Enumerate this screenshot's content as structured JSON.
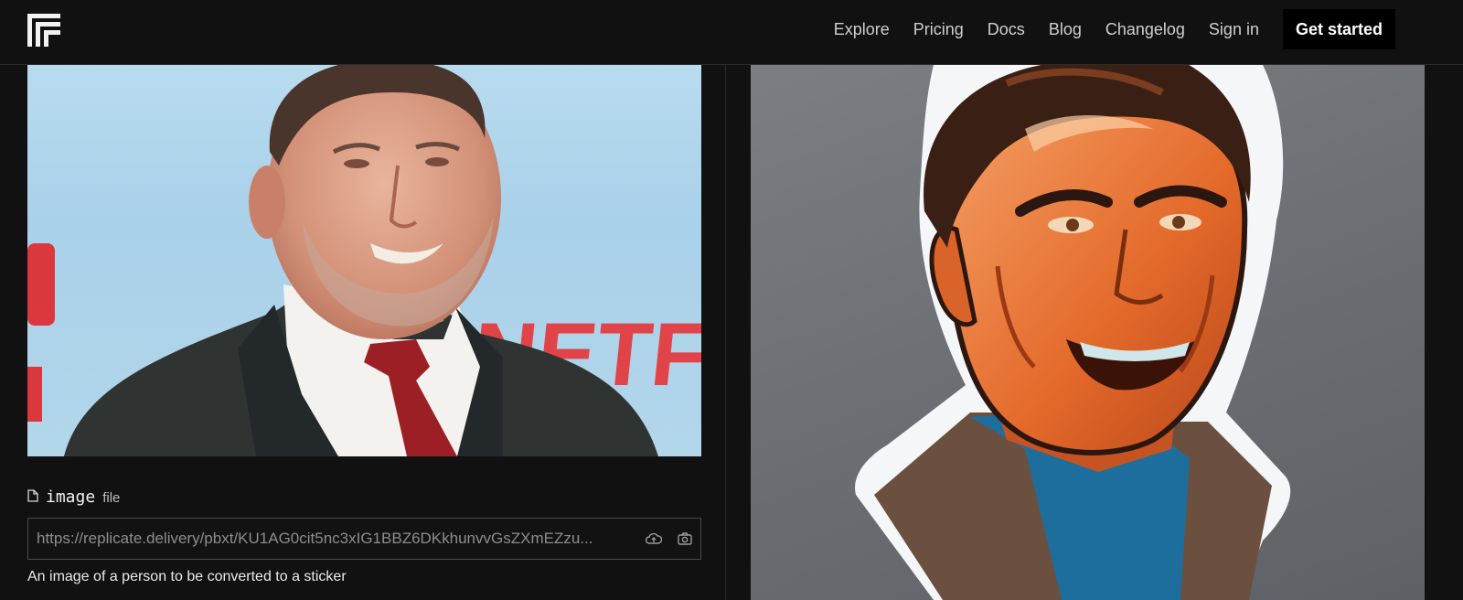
{
  "header": {
    "nav": [
      "Explore",
      "Pricing",
      "Docs",
      "Blog",
      "Changelog",
      "Sign in"
    ],
    "cta": "Get started"
  },
  "input": {
    "field_name": "image",
    "field_type": "file",
    "value": "https://replicate.delivery/pbxt/KU1AG0cit5nc3xIG1BBZ6DKkhunvvGsZXmEZzu...",
    "description": "An image of a person to be converted to a sticker",
    "icons": [
      "upload-cloud-icon",
      "camera-icon"
    ]
  },
  "photo": {
    "background_text": "NETFL"
  },
  "colors": {
    "page_bg": "#111111",
    "cta_bg": "#000000",
    "sticker_orange": "#e8732a"
  }
}
